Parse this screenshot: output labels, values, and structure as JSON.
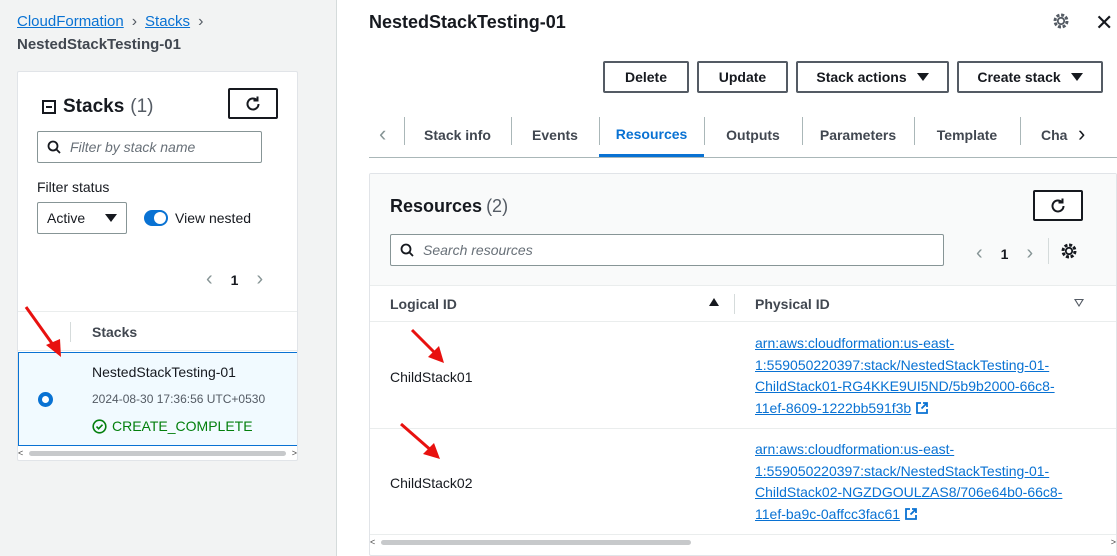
{
  "breadcrumb": {
    "items": [
      "CloudFormation",
      "Stacks"
    ],
    "current": "NestedStackTesting-01"
  },
  "stacks_panel": {
    "title": "Stacks",
    "count": "(1)",
    "search_placeholder": "Filter by stack name",
    "filter_label": "Filter status",
    "filter_value": "Active",
    "view_nested_label": "View nested",
    "page": "1",
    "column_header": "Stacks",
    "stack": {
      "name": "NestedStackTesting-01",
      "timestamp": "2024-08-30 17:36:56 UTC+0530",
      "status": "CREATE_COMPLETE"
    }
  },
  "main": {
    "title": "NestedStackTesting-01",
    "buttons": {
      "delete": "Delete",
      "update": "Update",
      "stack_actions": "Stack actions",
      "create_stack": "Create stack"
    },
    "tabs": [
      "Stack info",
      "Events",
      "Resources",
      "Outputs",
      "Parameters",
      "Template",
      "Cha"
    ],
    "active_tab": "Resources"
  },
  "resources": {
    "title": "Resources",
    "count": "(2)",
    "search_placeholder": "Search resources",
    "page": "1",
    "columns": {
      "logical_id": "Logical ID",
      "physical_id": "Physical ID"
    },
    "rows": [
      {
        "logical_id": "ChildStack01",
        "physical_id": "arn:aws:cloudformation:us-east-1:559050220397:stack/NestedStackTesting-01-ChildStack01-RG4KKE9UI5ND/5b9b2000-66c8-11ef-8609-1222bb591f3b",
        "lines": [
          "arn:aws:cloudformation:us-east-",
          "1:559050220397:stack/NestedStackTesting-01-",
          "ChildStack01-RG4KKE9UI5ND/5b9b2000-66c8-",
          "11ef-8609-1222bb591f3b"
        ]
      },
      {
        "logical_id": "ChildStack02",
        "physical_id": "arn:aws:cloudformation:us-east-1:559050220397:stack/NestedStackTesting-01-ChildStack02-NGZDGOULZAS8/706e64b0-66c8-11ef-ba9c-0affcc3fac61",
        "lines": [
          "arn:aws:cloudformation:us-east-",
          "1:559050220397:stack/NestedStackTesting-01-",
          "ChildStack02-NGZDGOULZAS8/706e64b0-66c8-",
          "11ef-ba9c-0affcc3fac61"
        ]
      }
    ]
  },
  "colors": {
    "link": "#0972d3",
    "success": "#037f0c",
    "annotation_arrow": "#e8110f"
  },
  "icons": [
    "refresh-icon",
    "search-icon",
    "gear-icon",
    "close-icon",
    "external-link-icon",
    "check-circle-icon",
    "annotation-arrow"
  ]
}
